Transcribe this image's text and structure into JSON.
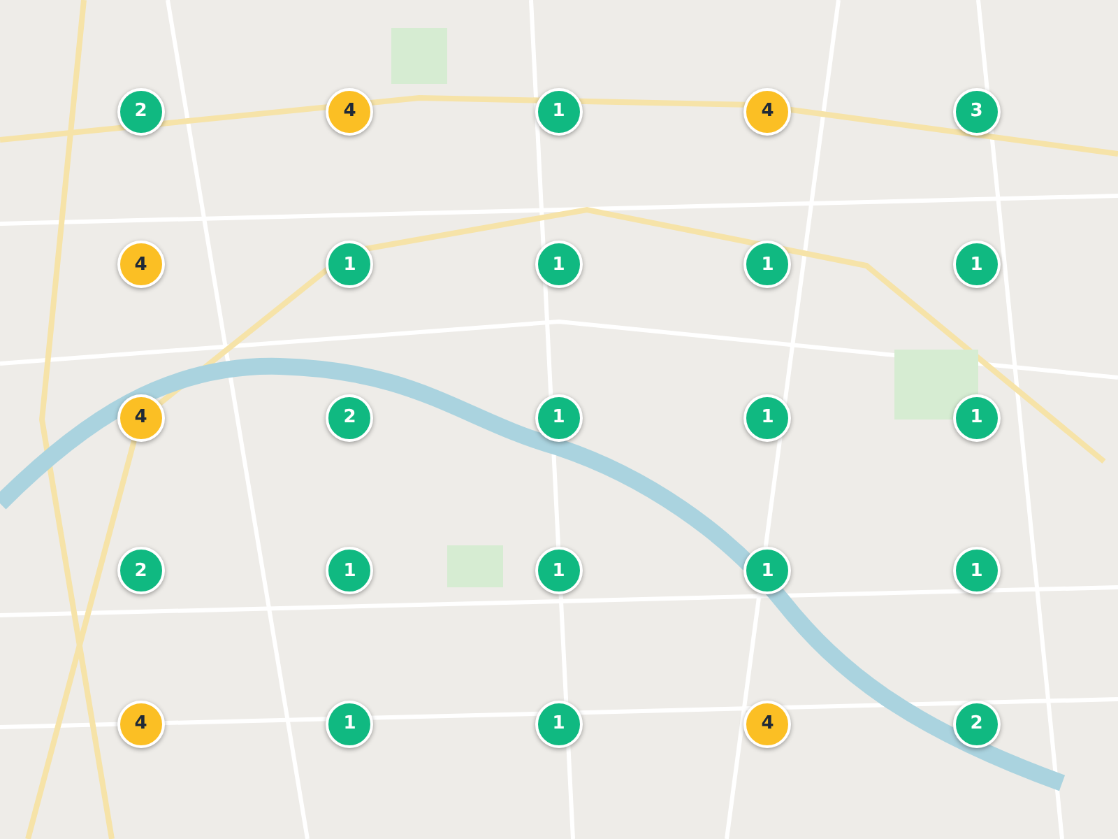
{
  "map": {
    "clusters": [
      {
        "count": "2",
        "color": "#10b981"
      },
      {
        "count": "4",
        "color": "#fbbf24"
      },
      {
        "count": "1",
        "color": "#10b981"
      },
      {
        "count": "4",
        "color": "#fbbf24"
      },
      {
        "count": "3",
        "color": "#10b981"
      },
      {
        "count": "4",
        "color": "#fbbf24"
      },
      {
        "count": "1",
        "color": "#10b981"
      },
      {
        "count": "1",
        "color": "#10b981"
      },
      {
        "count": "1",
        "color": "#10b981"
      },
      {
        "count": "1",
        "color": "#10b981"
      },
      {
        "count": "4",
        "color": "#fbbf24"
      },
      {
        "count": "2",
        "color": "#10b981"
      },
      {
        "count": "1",
        "color": "#10b981"
      },
      {
        "count": "1",
        "color": "#10b981"
      },
      {
        "count": "1",
        "color": "#10b981"
      },
      {
        "count": "2",
        "color": "#10b981"
      },
      {
        "count": "1",
        "color": "#10b981"
      },
      {
        "count": "1",
        "color": "#10b981"
      },
      {
        "count": "1",
        "color": "#10b981"
      },
      {
        "count": "1",
        "color": "#10b981"
      },
      {
        "count": "4",
        "color": "#fbbf24"
      },
      {
        "count": "1",
        "color": "#10b981"
      },
      {
        "count": "1",
        "color": "#10b981"
      },
      {
        "count": "4",
        "color": "#fbbf24"
      },
      {
        "count": "2",
        "color": "#10b981"
      }
    ]
  }
}
